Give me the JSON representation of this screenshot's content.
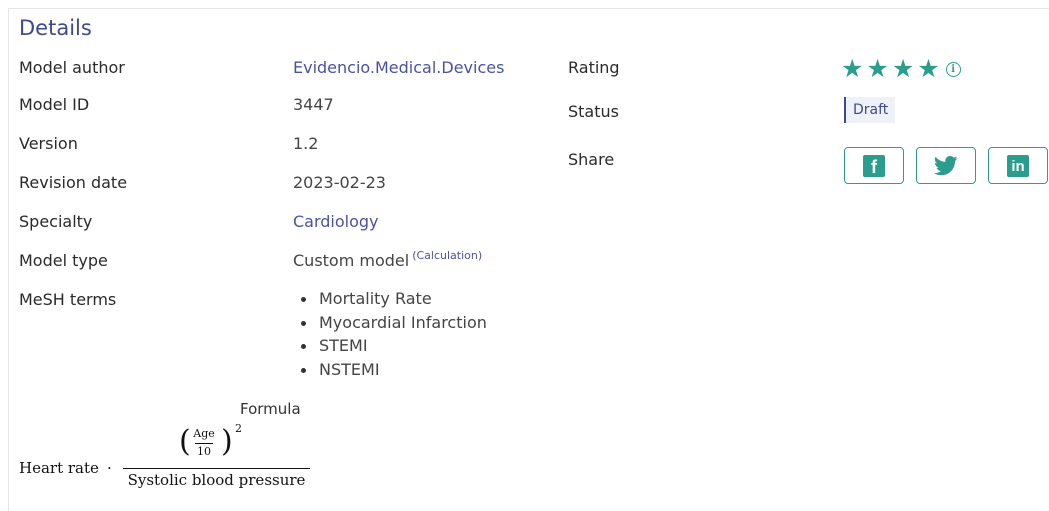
{
  "section_title": "Details",
  "details": {
    "author_label": "Model author",
    "author_value": "Evidencio.Medical.Devices",
    "id_label": "Model ID",
    "id_value": "3447",
    "version_label": "Version",
    "version_value": "1.2",
    "revision_label": "Revision date",
    "revision_value": "2023-02-23",
    "specialty_label": "Specialty",
    "specialty_value": "Cardiology",
    "type_label": "Model type",
    "type_value": "Custom model",
    "type_sup": "(Calculation)",
    "mesh_label": "MeSH terms",
    "mesh_terms": [
      "Mortality Rate",
      "Myocardial Infarction",
      "STEMI",
      "NSTEMI"
    ]
  },
  "side": {
    "rating_label": "Rating",
    "rating_stars": 4,
    "rating_icon": "info-icon",
    "status_label": "Status",
    "status_value": "Draft",
    "share_label": "Share",
    "share_buttons": [
      "facebook-icon",
      "twitter-icon",
      "linkedin-icon"
    ],
    "accent_color": "#2a9d8f"
  },
  "formula": {
    "title": "Formula",
    "prefix": "Heart rate",
    "dot": "·",
    "num_top": "Age",
    "num_bottom": "10",
    "exponent": "2",
    "denominator": "Systolic blood pressure"
  }
}
